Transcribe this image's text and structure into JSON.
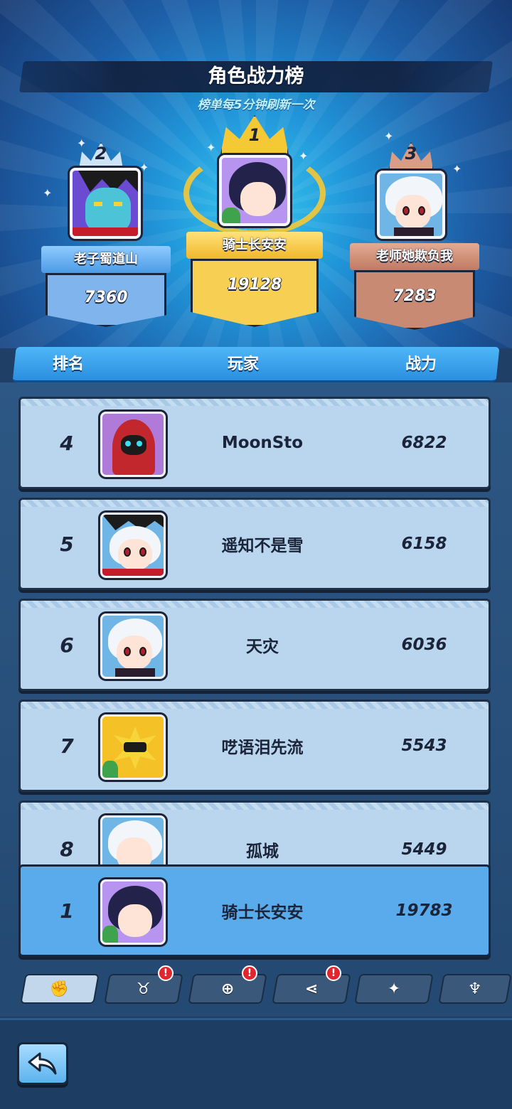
{
  "header": {
    "title": "角色战力榜",
    "subtitle": "榜单每5分钟刷新一次"
  },
  "podium": {
    "first": {
      "rank": "1",
      "name": "骑士长安安",
      "score": "19128"
    },
    "second": {
      "rank": "2",
      "name": "老子蜀道山",
      "score": "7360"
    },
    "third": {
      "rank": "3",
      "name": "老师她欺负我",
      "score": "7283"
    }
  },
  "columns": {
    "rank": "排名",
    "player": "玩家",
    "power": "战力"
  },
  "rows": [
    {
      "rank": "4",
      "name": "MoonSto",
      "power": "6822"
    },
    {
      "rank": "5",
      "name": "遥知不是雪",
      "power": "6158"
    },
    {
      "rank": "6",
      "name": "天灾",
      "power": "6036"
    },
    {
      "rank": "7",
      "name": "呓语泪先流",
      "power": "5543"
    },
    {
      "rank": "8",
      "name": "孤城",
      "power": "5449"
    }
  ],
  "self_row": {
    "rank": "1",
    "name": "骑士长安安",
    "power": "19783"
  },
  "tabs": [
    {
      "icon": "fist-icon",
      "glyph": "✊",
      "active": true,
      "alert": false
    },
    {
      "icon": "horned-helmet-icon",
      "glyph": "♉",
      "active": false,
      "alert": true
    },
    {
      "icon": "shield-icon",
      "glyph": "⊕",
      "active": false,
      "alert": true
    },
    {
      "icon": "share-icon",
      "glyph": "⋖",
      "active": false,
      "alert": true
    },
    {
      "icon": "sword-icon",
      "glyph": "✦",
      "active": false,
      "alert": false
    },
    {
      "icon": "demon-icon",
      "glyph": "♆",
      "active": false,
      "alert": false
    }
  ],
  "alert_mark": "!",
  "back_button": {
    "icon": "back-arrow-icon"
  },
  "colors": {
    "gold": "#f5c836",
    "silver": "#7fb8ee",
    "bronze": "#c98a73",
    "row_bg": "#b9d6ee",
    "self_row_bg": "#5aabeb",
    "header_blue": "#3ea6f0"
  }
}
